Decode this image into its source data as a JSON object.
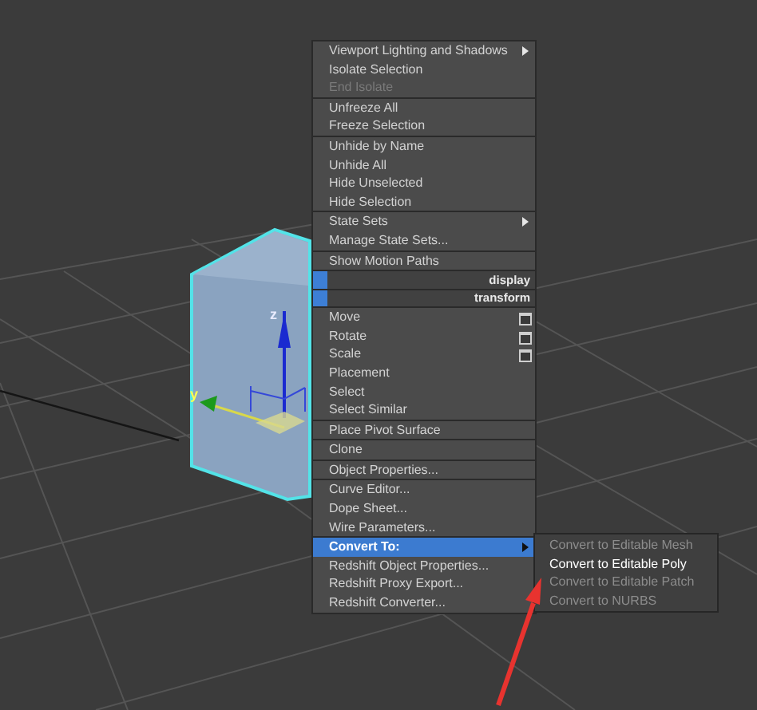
{
  "menu": {
    "groups": [
      [
        {
          "label": "Viewport Lighting and Shadows",
          "kind": "item",
          "submenu": true,
          "disabled": false,
          "selected": false
        },
        {
          "label": "Isolate Selection",
          "kind": "item",
          "submenu": false,
          "disabled": false,
          "selected": false
        },
        {
          "label": "End Isolate",
          "kind": "item",
          "submenu": false,
          "disabled": true,
          "selected": false
        }
      ],
      [
        {
          "label": "Unfreeze All",
          "kind": "item",
          "submenu": false,
          "disabled": false,
          "selected": false
        },
        {
          "label": "Freeze Selection",
          "kind": "item",
          "submenu": false,
          "disabled": false,
          "selected": false
        }
      ],
      [
        {
          "label": "Unhide by Name",
          "kind": "item",
          "submenu": false,
          "disabled": false,
          "selected": false
        },
        {
          "label": "Unhide All",
          "kind": "item",
          "submenu": false,
          "disabled": false,
          "selected": false
        },
        {
          "label": "Hide Unselected",
          "kind": "item",
          "submenu": false,
          "disabled": false,
          "selected": false
        },
        {
          "label": "Hide Selection",
          "kind": "item",
          "submenu": false,
          "disabled": false,
          "selected": false
        }
      ],
      [
        {
          "label": "State Sets",
          "kind": "item",
          "submenu": true,
          "disabled": false,
          "selected": false
        },
        {
          "label": "Manage State Sets...",
          "kind": "item",
          "submenu": false,
          "disabled": false,
          "selected": false
        }
      ],
      [
        {
          "label": "Show Motion Paths",
          "kind": "item",
          "submenu": false,
          "disabled": false,
          "selected": false
        }
      ],
      [
        {
          "label": "display",
          "kind": "header"
        }
      ],
      [
        {
          "label": "transform",
          "kind": "header"
        }
      ],
      [
        {
          "label": "Move",
          "kind": "option",
          "submenu": false,
          "disabled": false,
          "selected": false
        },
        {
          "label": "Rotate",
          "kind": "option",
          "submenu": false,
          "disabled": false,
          "selected": false
        },
        {
          "label": "Scale",
          "kind": "option",
          "submenu": false,
          "disabled": false,
          "selected": false
        },
        {
          "label": "Placement",
          "kind": "item",
          "submenu": false,
          "disabled": false,
          "selected": false
        },
        {
          "label": "Select",
          "kind": "item",
          "submenu": false,
          "disabled": false,
          "selected": false
        },
        {
          "label": "Select Similar",
          "kind": "item",
          "submenu": false,
          "disabled": false,
          "selected": false
        }
      ],
      [
        {
          "label": "Place Pivot Surface",
          "kind": "item",
          "submenu": false,
          "disabled": false,
          "selected": false
        }
      ],
      [
        {
          "label": "Clone",
          "kind": "item",
          "submenu": false,
          "disabled": false,
          "selected": false
        }
      ],
      [
        {
          "label": "Object Properties...",
          "kind": "item",
          "submenu": false,
          "disabled": false,
          "selected": false
        }
      ],
      [
        {
          "label": "Curve Editor...",
          "kind": "item",
          "submenu": false,
          "disabled": false,
          "selected": false
        },
        {
          "label": "Dope Sheet...",
          "kind": "item",
          "submenu": false,
          "disabled": false,
          "selected": false
        },
        {
          "label": "Wire Parameters...",
          "kind": "item",
          "submenu": false,
          "disabled": false,
          "selected": false
        }
      ],
      [
        {
          "label": "Convert To:",
          "kind": "item",
          "submenu": true,
          "disabled": false,
          "selected": true
        },
        {
          "label": "Redshift Object Properties...",
          "kind": "item",
          "submenu": false,
          "disabled": false,
          "selected": false
        },
        {
          "label": "Redshift Proxy Export...",
          "kind": "item",
          "submenu": false,
          "disabled": false,
          "selected": false
        },
        {
          "label": "Redshift Converter...",
          "kind": "item",
          "submenu": false,
          "disabled": false,
          "selected": false
        }
      ]
    ]
  },
  "submenu": {
    "items": [
      {
        "label": "Convert to Editable Mesh",
        "selected": false
      },
      {
        "label": "Convert to Editable Poly",
        "selected": true
      },
      {
        "label": "Convert to Editable Patch",
        "selected": false
      },
      {
        "label": "Convert to NURBS",
        "selected": false
      }
    ]
  },
  "axis_labels": [
    {
      "label": "z"
    },
    {
      "label": "y"
    }
  ]
}
